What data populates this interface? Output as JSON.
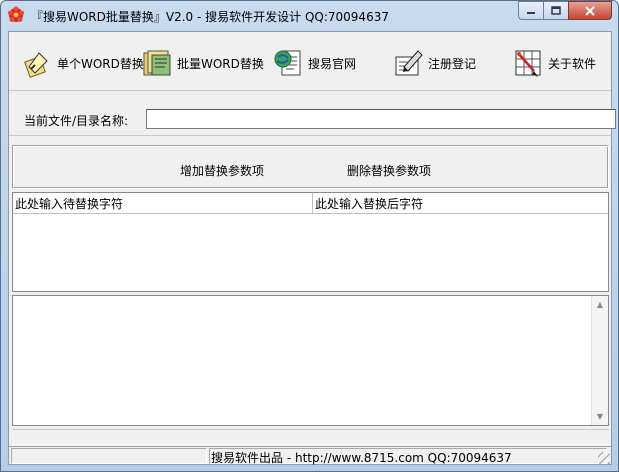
{
  "window": {
    "title": "『搜易WORD批量替换』V2.0    - 搜易软件开发设计 QQ:70094637"
  },
  "toolbar": {
    "items": [
      {
        "label": "单个WORD替换",
        "icon": "single-replace-icon"
      },
      {
        "label": "批量WORD替换",
        "icon": "batch-replace-icon"
      },
      {
        "label": "搜易官网",
        "icon": "website-icon"
      },
      {
        "label": "注册登记",
        "icon": "register-icon"
      },
      {
        "label": "关于软件",
        "icon": "about-icon"
      }
    ]
  },
  "path": {
    "label": "当前文件/目录名称:",
    "value": ""
  },
  "actions": {
    "add_label": "增加替换参数项",
    "delete_label": "删除替换参数项"
  },
  "grid": {
    "columns": [
      "此处输入待替换字符",
      "此处输入替换后字符"
    ]
  },
  "status": {
    "text": "搜易软件出品 - http://www.8715.com QQ:70094637"
  }
}
